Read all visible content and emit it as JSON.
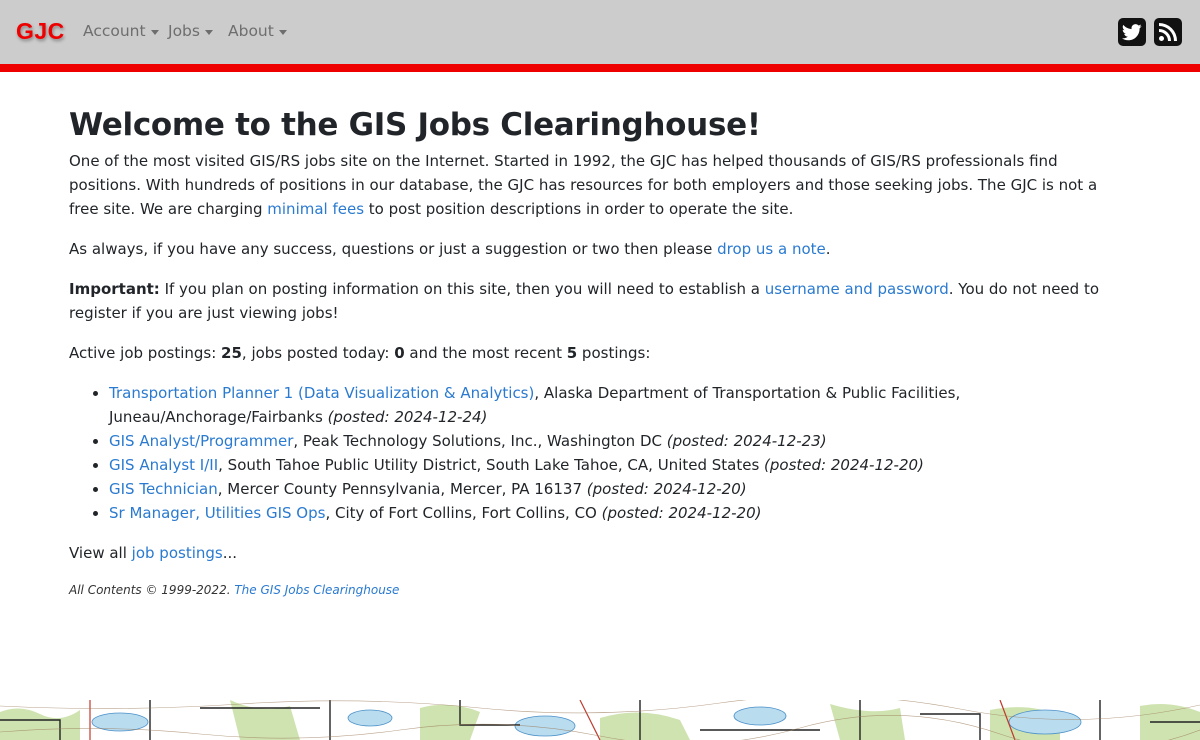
{
  "nav": {
    "brand": "GJC",
    "menu": [
      {
        "label": "Account"
      },
      {
        "label": "Jobs"
      },
      {
        "label": "About"
      }
    ],
    "social": [
      "twitter-icon",
      "rss-icon"
    ]
  },
  "main": {
    "title": "Welcome to the GIS Jobs Clearinghouse!",
    "intro": {
      "text_1": "One of the most visited GIS/RS jobs site on the Internet. Started in 1992, the GJC has helped thousands of GIS/RS professionals find positions. With hundreds of positions in our database, the GJC has resources for both employers and those seeking jobs. The GJC is not a free site. We are charging ",
      "link": "minimal fees",
      "text_2": " to post position descriptions in order to operate the site."
    },
    "note": {
      "text_1": "As always, if you have any success, questions or just a suggestion or two then please ",
      "link": "drop us a note",
      "text_2": "."
    },
    "important": {
      "label": "Important:",
      "text_1": " If you plan on posting information on this site, then you will need to establish a ",
      "link": "username and password",
      "text_2": ". You do not need to register if you are just viewing jobs!"
    },
    "stats": {
      "prefix": "Active job postings: ",
      "active": "25",
      "mid": ", jobs posted today: ",
      "today": "0",
      "mid2": " and the most recent ",
      "recent": "5",
      "suffix": " postings:"
    },
    "jobs": [
      {
        "title": "Transportation Planner 1 (Data Visualization & Analytics)",
        "detail": ", Alaska Department of Transportation & Public Facilities, Juneau/Anchorage/Fairbanks ",
        "posted": "(posted: 2024-12-24)"
      },
      {
        "title": "GIS Analyst/Programmer",
        "detail": ", Peak Technology Solutions, Inc., Washington DC ",
        "posted": "(posted: 2024-12-23)"
      },
      {
        "title": "GIS Analyst I/II",
        "detail": ", South Tahoe Public Utility District, South Lake Tahoe, CA, United States ",
        "posted": "(posted: 2024-12-20)"
      },
      {
        "title": "GIS Technician",
        "detail": ", Mercer County Pennsylvania, Mercer, PA 16137 ",
        "posted": "(posted: 2024-12-20)"
      },
      {
        "title": "Sr Manager, Utilities GIS Ops",
        "detail": ", City of Fort Collins, Fort Collins, CO ",
        "posted": "(posted: 2024-12-20)"
      }
    ],
    "view_all": {
      "text_1": "View all ",
      "link": "job postings",
      "text_2": "..."
    }
  },
  "footer": {
    "text": "All Contents © 1999-2022. ",
    "link": "The GIS Jobs Clearinghouse"
  },
  "colors": {
    "navbar_bg": "#cccccc",
    "accent_red": "#ee0000",
    "link": "#2a7ad0",
    "text": "#212529"
  }
}
